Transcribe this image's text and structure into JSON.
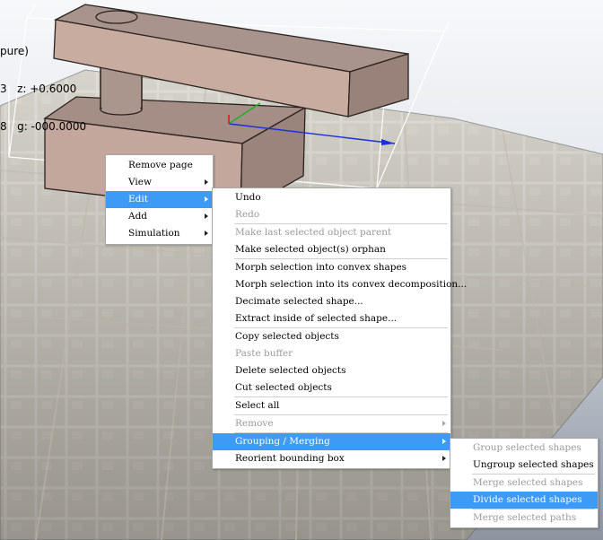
{
  "hud": {
    "line1": "pure)",
    "line2": "3   z: +0.6000",
    "line3": "8   g: -000.0000"
  },
  "colors": {
    "menu_highlight": "#3d9af5",
    "disabled_text": "#9a9a9a",
    "object_face": "#c2a49a"
  },
  "context_menu": {
    "items": [
      {
        "label": "Remove page",
        "state": "normal",
        "submenu": false
      },
      {
        "label": "View",
        "state": "normal",
        "submenu": true
      },
      {
        "label": "Edit",
        "state": "selected",
        "submenu": true
      },
      {
        "label": "Add",
        "state": "normal",
        "submenu": true
      },
      {
        "label": "Simulation",
        "state": "normal",
        "submenu": true
      }
    ]
  },
  "edit_menu": {
    "items": [
      {
        "label": "Undo",
        "state": "normal"
      },
      {
        "label": "Redo",
        "state": "disabled"
      },
      {
        "label": "Make last selected object parent",
        "state": "disabled"
      },
      {
        "label": "Make selected object(s) orphan",
        "state": "normal"
      },
      {
        "label": "Morph selection into convex shapes",
        "state": "normal"
      },
      {
        "label": "Morph selection into its convex decomposition...",
        "state": "normal"
      },
      {
        "label": "Decimate selected shape...",
        "state": "normal"
      },
      {
        "label": "Extract inside of selected shape...",
        "state": "normal"
      },
      {
        "label": "Copy selected objects",
        "state": "normal"
      },
      {
        "label": "Paste buffer",
        "state": "disabled"
      },
      {
        "label": "Delete selected objects",
        "state": "normal"
      },
      {
        "label": "Cut selected objects",
        "state": "normal"
      },
      {
        "label": "Select all",
        "state": "normal"
      },
      {
        "label": "Remove",
        "state": "disabled"
      },
      {
        "label": "Grouping / Merging",
        "state": "selected"
      },
      {
        "label": "Reorient bounding box",
        "state": "normal"
      }
    ]
  },
  "grouping_menu": {
    "items": [
      {
        "label": "Group selected shapes",
        "state": "disabled"
      },
      {
        "label": "Ungroup selected shapes",
        "state": "normal"
      },
      {
        "label": "Merge selected shapes",
        "state": "disabled"
      },
      {
        "label": "Divide selected shapes",
        "state": "selected"
      },
      {
        "label": "Merge selected paths",
        "state": "disabled"
      }
    ]
  }
}
